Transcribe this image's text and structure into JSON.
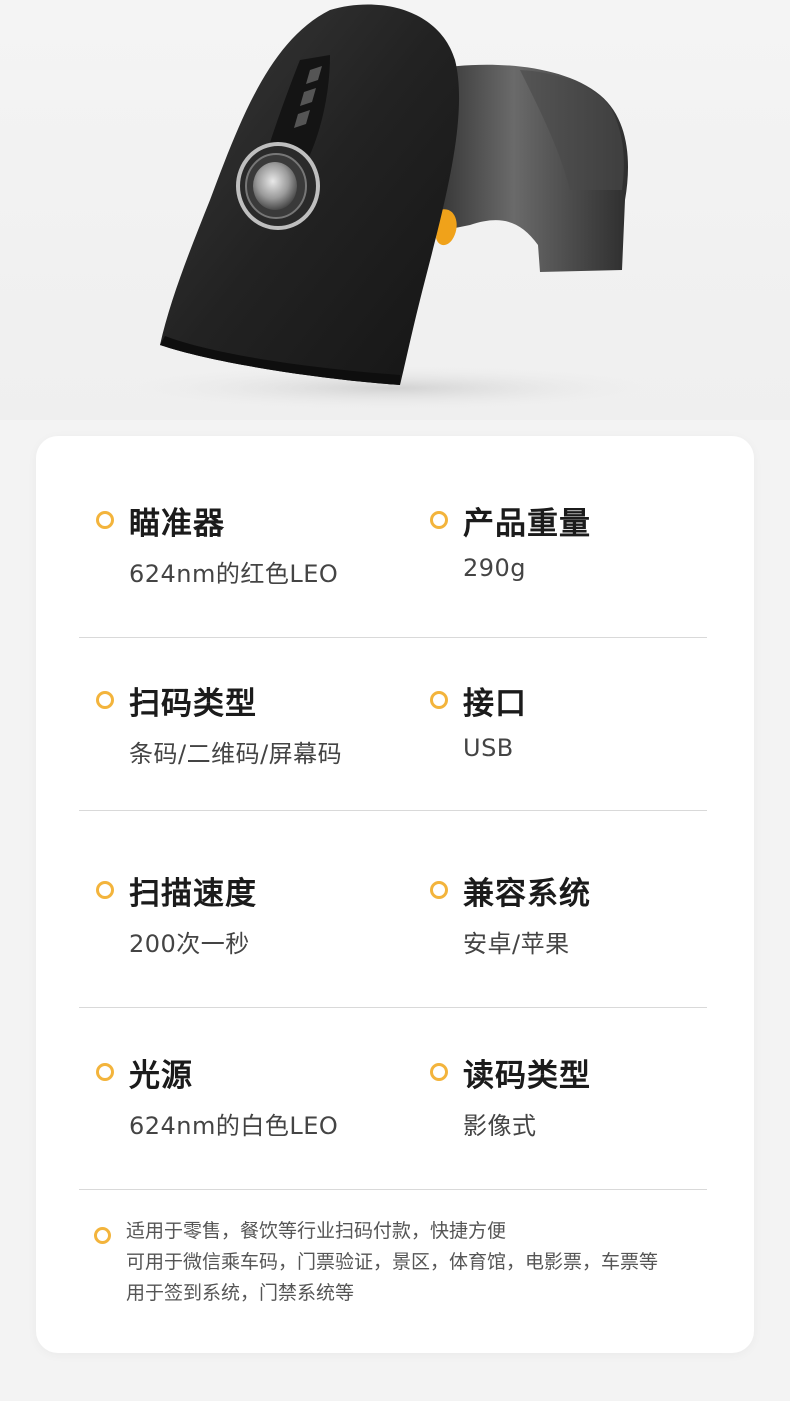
{
  "specs": [
    {
      "title": "瞄准器",
      "value": "624nm的红色LEO"
    },
    {
      "title": "产品重量",
      "value": "290g"
    },
    {
      "title": "扫码类型",
      "value": "条码/二维码/屏幕码"
    },
    {
      "title": "接口",
      "value": "USB"
    },
    {
      "title": "扫描速度",
      "value": "200次一秒"
    },
    {
      "title": "兼容系统",
      "value": "安卓/苹果"
    },
    {
      "title": "光源",
      "value": "624nm的白色LEO"
    },
    {
      "title": "读码类型",
      "value": "影像式"
    }
  ],
  "usage": {
    "lines": [
      "适用于零售，餐饮等行业扫码付款，快捷方便",
      "可用于微信乘车码，门票验证，景区，体育馆，电影票，车票等",
      "用于签到系统，门禁系统等"
    ]
  },
  "colors": {
    "accent": "#f3b43c",
    "card_bg": "#ffffff",
    "page_bg": "#f3f3f3"
  }
}
